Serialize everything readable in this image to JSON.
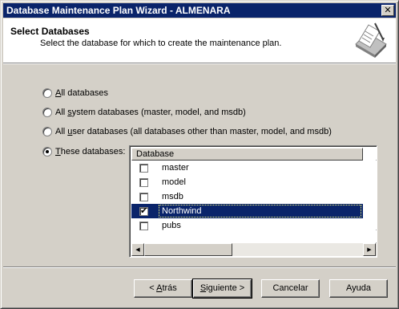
{
  "window": {
    "title": "Database Maintenance Plan Wizard - ALMENARA",
    "close_glyph": "✕"
  },
  "header": {
    "title": "Select Databases",
    "subtitle": "Select the database for which to create the maintenance plan.",
    "icon": "wizard-clipboard-icon"
  },
  "options": [
    {
      "accel": "A",
      "rest": "ll databases",
      "checked": false
    },
    {
      "pre": "All ",
      "accel": "s",
      "rest": "ystem databases (master, model, and msdb)",
      "checked": false
    },
    {
      "pre": "All ",
      "accel": "u",
      "rest": "ser databases (all databases other than master, model, and msdb)",
      "checked": false
    },
    {
      "accel": "T",
      "rest": "hese databases:",
      "checked": true
    }
  ],
  "listview": {
    "column": "Database",
    "rows": [
      {
        "name": "master",
        "checked": false,
        "selected": false
      },
      {
        "name": "model",
        "checked": false,
        "selected": false
      },
      {
        "name": "msdb",
        "checked": false,
        "selected": false
      },
      {
        "name": "Northwind",
        "checked": true,
        "selected": true
      },
      {
        "name": "pubs",
        "checked": false,
        "selected": false
      }
    ]
  },
  "buttons": {
    "back_pre": "< ",
    "back_accel": "A",
    "back_rest": "trás",
    "next_accel": "S",
    "next_rest": "iguiente >",
    "cancel": "Cancelar",
    "help": "Ayuda"
  }
}
